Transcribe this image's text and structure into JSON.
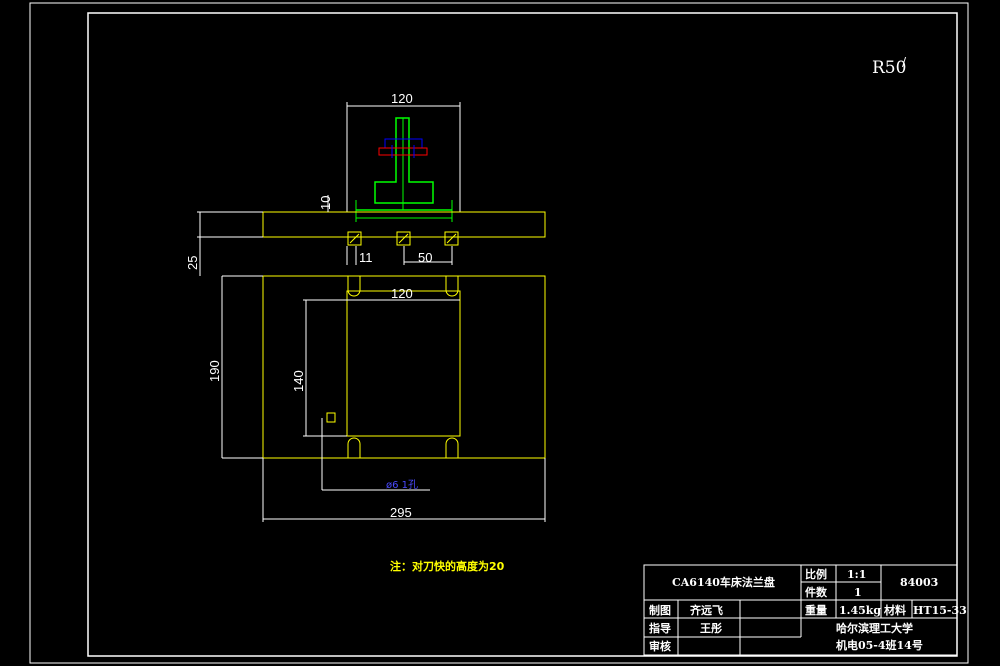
{
  "drawing": {
    "roughness": "R50",
    "roughness_mark": "/",
    "dims": {
      "top_width": "120",
      "gap_height": "10",
      "left_height": "25",
      "hole_offset": "11",
      "hole_pitch": "50",
      "inner_width": "120",
      "inner_height": "140",
      "outer_height": "190",
      "overall_width": "295",
      "blue_label": "ø6 1孔"
    },
    "note": "注：对刀快的高度为20"
  },
  "title_block": {
    "part_name": "CA6140车床法兰盘",
    "scale_label": "比例",
    "scale_value": "1:1",
    "qty_label": "件数",
    "qty_value": "1",
    "drawing_no": "84003",
    "drawn_label": "制图",
    "drawn_by": "齐远飞",
    "weight_label": "重量",
    "weight_value": "1.45kg",
    "material_label": "材料",
    "material_value": "HT15-33",
    "guide_label": "指导",
    "guide_by": "王彤",
    "school": "哈尔滨理工大学",
    "class": "机电05-4班14号",
    "review_label": "审核"
  },
  "colors": {
    "frame": "#ffffff",
    "part": "#ffff00",
    "dimension": "#ffffff",
    "green": "#00ff00",
    "blue": "#0000ff",
    "red": "#ff0000"
  }
}
